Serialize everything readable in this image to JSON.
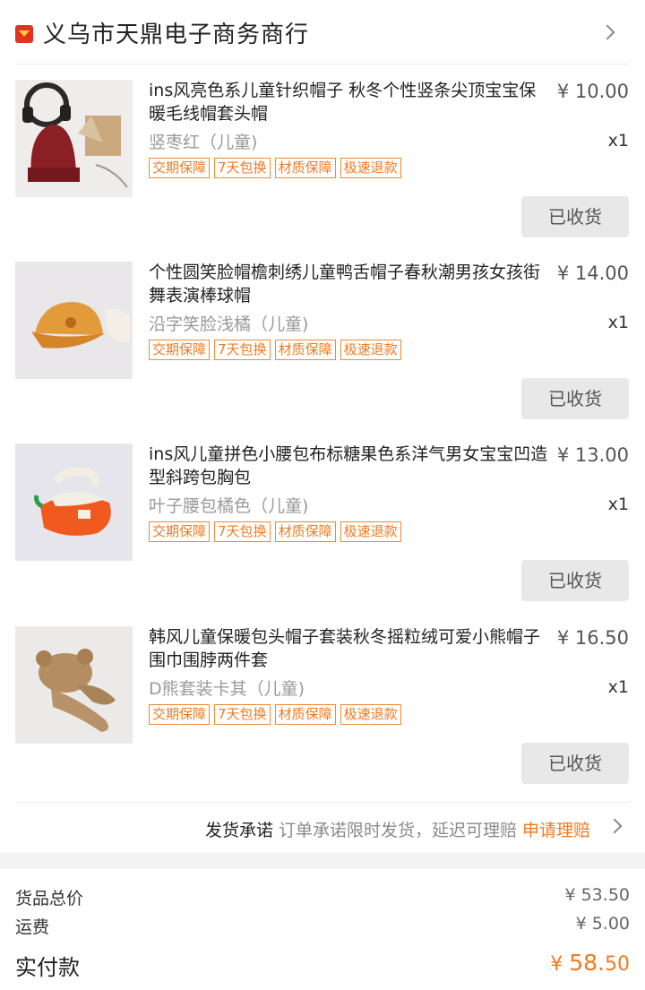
{
  "shop": {
    "name": "义乌市天鼎电子商务商行"
  },
  "tags": [
    "交期保障",
    "7天包换",
    "材质保障",
    "极速退款"
  ],
  "items": [
    {
      "title": "ins风亮色系儿童针织帽子 秋冬个性竖条尖顶宝宝保暖毛线帽套头帽",
      "price": "¥ 10.00",
      "variant": "竖枣红（儿童)",
      "qty": "x1",
      "status": "已收货"
    },
    {
      "title": "个性圆笑脸帽檐刺绣儿童鸭舌帽子春秋潮男孩女孩街舞表演棒球帽",
      "price": "¥ 14.00",
      "variant": "沿字笑脸浅橘（儿童)",
      "qty": "x1",
      "status": "已收货"
    },
    {
      "title": "ins风儿童拼色小腰包布标糖果色系洋气男女宝宝凹造型斜跨包胸包",
      "price": "¥ 13.00",
      "variant": "叶子腰包橘色（儿童)",
      "qty": "x1",
      "status": "已收货"
    },
    {
      "title": "韩风儿童保暖包头帽子套装秋冬摇粒绒可爱小熊帽子围巾围脖两件套",
      "price": "¥ 16.50",
      "variant": "D熊套装卡其（儿童)",
      "qty": "x1",
      "status": "已收货"
    }
  ],
  "promise": {
    "title": "发货承诺",
    "desc": "订单承诺限时发货，延迟可理赔",
    "link": "申请理赔"
  },
  "summary": {
    "goods_label": "货品总价",
    "goods_value": "¥ 53.50",
    "shipping_label": "运费",
    "shipping_value": "¥ 5.00",
    "total_label": "实付款",
    "total_currency": "¥ ",
    "total_int": "58.",
    "total_dec": "50"
  },
  "colors": {
    "accent": "#f07a22",
    "shop_icon": "#e5321e"
  }
}
